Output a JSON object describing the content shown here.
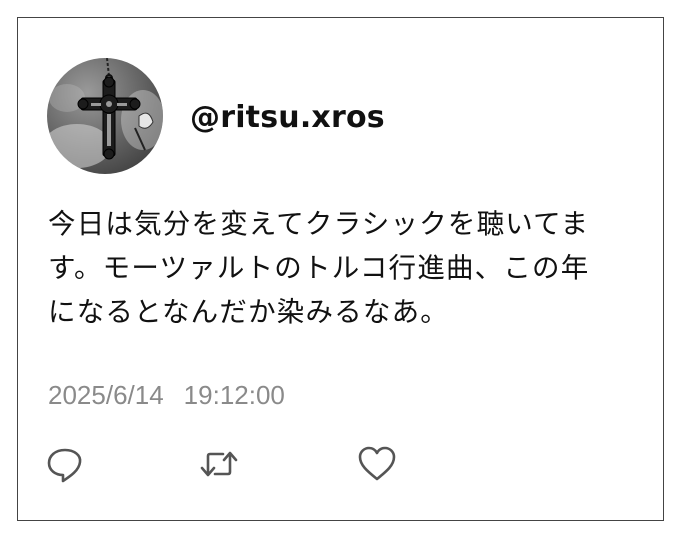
{
  "post": {
    "handle": "@ritsu.xros",
    "body_lines": [
      "今日は気分を変えてクラシックを聴いてま",
      "す。モーツァルトのトルコ行進曲、この年",
      "になるとなんだか染みるなあ。"
    ],
    "date": "2025/6/14",
    "time": "19:12:00"
  },
  "avatar": {
    "icon": "ornate-cross-icon"
  },
  "actions": [
    {
      "icon": "reply-icon"
    },
    {
      "icon": "retweet-icon"
    },
    {
      "icon": "like-heart-icon"
    }
  ],
  "colors": {
    "text": "#111111",
    "timestamp": "#8a8a8a",
    "icon": "#555555",
    "border": "#444444"
  }
}
